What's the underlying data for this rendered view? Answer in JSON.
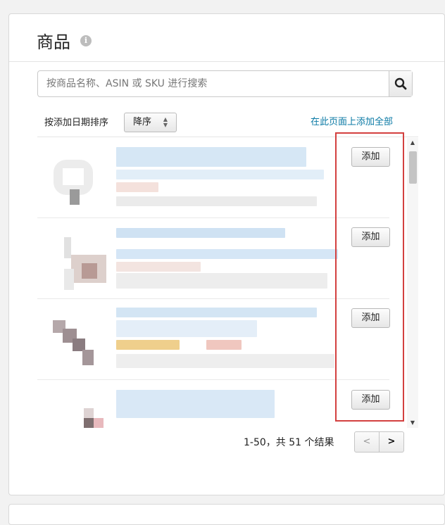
{
  "header": {
    "title": "商品",
    "info_icon": "info-icon"
  },
  "search": {
    "placeholder": "按商品名称、ASIN 或 SKU 进行搜索",
    "value": "",
    "button_icon": "search-icon"
  },
  "sort": {
    "label": "按添加日期排序",
    "selected": "降序",
    "options": [
      "降序"
    ]
  },
  "add_all_label": "在此页面上添加全部",
  "products": [
    {
      "add_label": "添加"
    },
    {
      "add_label": "添加"
    },
    {
      "add_label": "添加"
    },
    {
      "add_label": "添加"
    }
  ],
  "pagination": {
    "summary": "1-50，共 51 个结果",
    "prev_label": "<",
    "next_label": ">"
  },
  "colors": {
    "link": "#0b7aa5",
    "highlight_border": "#d3403f"
  }
}
